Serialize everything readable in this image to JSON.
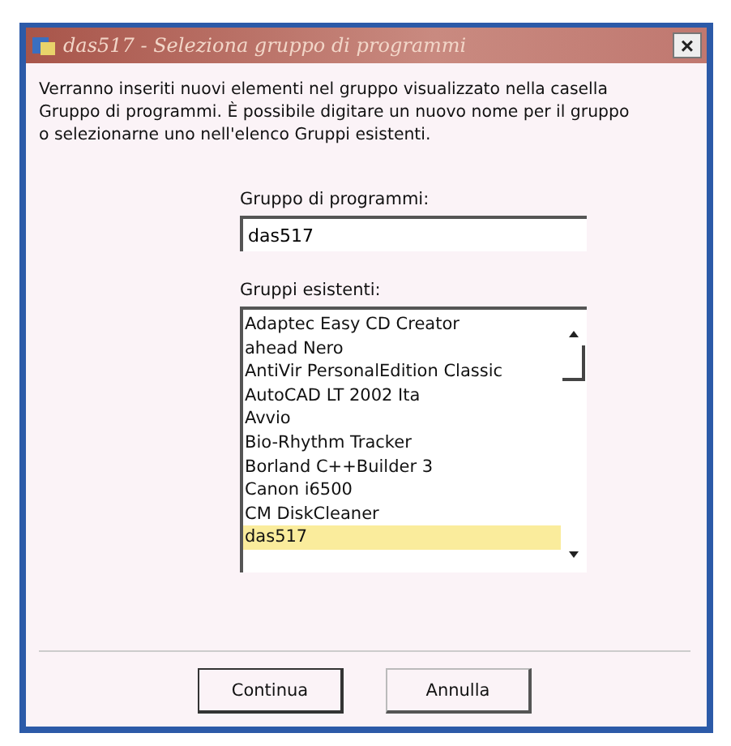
{
  "window": {
    "title": "das517 - Seleziona gruppo di programmi",
    "close": "×"
  },
  "intro": "Verranno inseriti nuovi elementi nel gruppo visualizzato nella casella Gruppo di programmi. È possibile digitare un nuovo nome per il gruppo o selezionarne uno nell'elenco Gruppi esistenti.",
  "group_field": {
    "label": "Gruppo di programmi:",
    "value": "das517"
  },
  "existing_groups": {
    "label": "Gruppi esistenti:",
    "items": [
      {
        "label": "Adaptec Easy CD Creator",
        "selected": false
      },
      {
        "label": "ahead Nero",
        "selected": false
      },
      {
        "label": "AntiVir PersonalEdition Classic",
        "selected": false
      },
      {
        "label": "AutoCAD LT 2002 Ita",
        "selected": false
      },
      {
        "label": "Avvio",
        "selected": false
      },
      {
        "label": "Bio-Rhythm Tracker",
        "selected": false
      },
      {
        "label": "Borland C++Builder 3",
        "selected": false
      },
      {
        "label": "Canon i6500",
        "selected": false
      },
      {
        "label": "CM DiskCleaner",
        "selected": false
      },
      {
        "label": "das517",
        "selected": true
      }
    ]
  },
  "buttons": [
    {
      "label": "Continua",
      "default": true
    },
    {
      "label": "Annulla",
      "default": false
    }
  ]
}
